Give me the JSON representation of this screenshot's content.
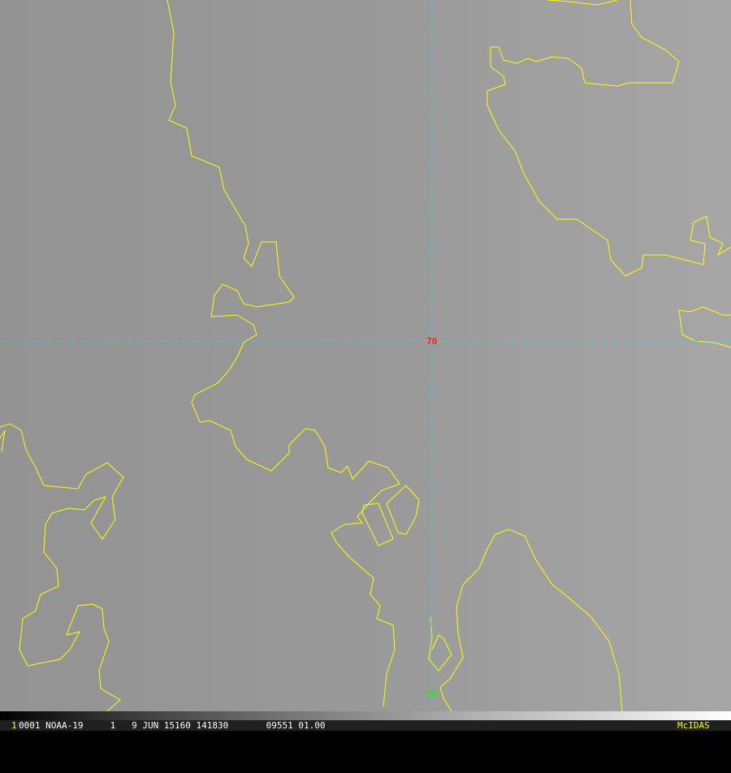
{
  "map": {
    "grid_labels": {
      "lat": "70",
      "lon": "90"
    },
    "colors": {
      "coast": "#ffff00",
      "grid": "#00e5ee",
      "lat_label": "#ff0000",
      "lon_label": "#00ff00",
      "background": "#9a9a9a"
    }
  },
  "status_bar": {
    "frame": "1",
    "info": "0001 NOAA-19     1   9 JUN 15160 141830       09551 01.00",
    "brand": "McIDAS"
  }
}
